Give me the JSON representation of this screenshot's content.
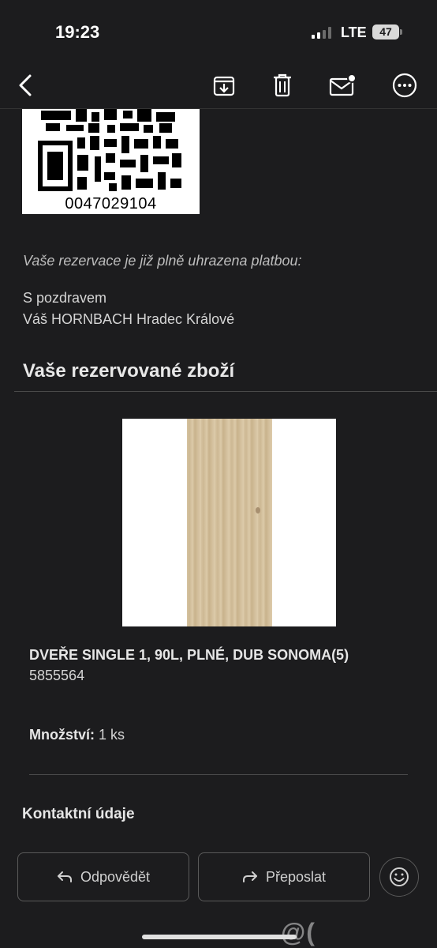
{
  "status": {
    "time": "19:23",
    "network": "LTE",
    "battery": "47"
  },
  "toolbar": {
    "icons": [
      "back-icon",
      "archive-icon",
      "trash-icon",
      "mark-unread-icon",
      "more-icon"
    ]
  },
  "email": {
    "reservation_number": "0047029104",
    "paid_text": "Vaše rezervace je již plně uhrazena platbou:",
    "greeting_line1": "S pozdravem",
    "greeting_line2": "Váš HORNBACH Hradec Králové",
    "section_title": "Vaše rezervované zboží",
    "product": {
      "name": "DVEŘE SINGLE 1, 90L, PLNÉ, DUB SONOMA(5)",
      "code": "5855564",
      "quantity_label": "Množství:",
      "quantity_value": "1 ks"
    },
    "contact_title": "Kontaktní údaje"
  },
  "actions": {
    "reply_label": "Odpovědět",
    "forward_label": "Přeposlat"
  },
  "watermark": "@( Bazos.cz"
}
